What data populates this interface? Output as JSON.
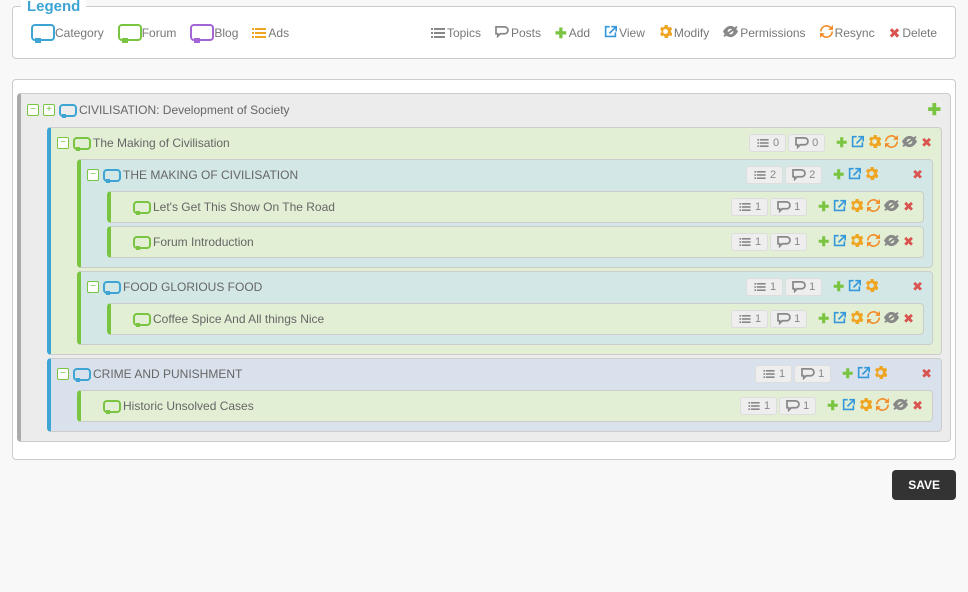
{
  "legend": {
    "title": "Legend",
    "types": [
      {
        "key": "category",
        "label": "Category",
        "icon": "cb-cat"
      },
      {
        "key": "forum",
        "label": "Forum",
        "icon": "cb-forum"
      },
      {
        "key": "blog",
        "label": "Blog",
        "icon": "cb-blog"
      },
      {
        "key": "ads",
        "label": "Ads",
        "icon": "list-lines"
      }
    ],
    "tools": [
      {
        "key": "topics",
        "label": "Topics",
        "icon": "list-gray"
      },
      {
        "key": "posts",
        "label": "Posts",
        "icon": "posts"
      },
      {
        "key": "add",
        "label": "Add",
        "icon": "plus"
      },
      {
        "key": "view",
        "label": "View",
        "icon": "view"
      },
      {
        "key": "modify",
        "label": "Modify",
        "icon": "gear"
      },
      {
        "key": "permissions",
        "label": "Permissions",
        "icon": "eye"
      },
      {
        "key": "resync",
        "label": "Resync",
        "icon": "resync"
      },
      {
        "key": "delete",
        "label": "Delete",
        "icon": "cross"
      }
    ]
  },
  "tree": [
    {
      "title": "CIVILISATION: Development of Society",
      "type": "category",
      "bg": "bg-gray",
      "bl": "bl-gray",
      "topics": null,
      "posts": null,
      "showAdd": true,
      "actions": [],
      "children": [
        {
          "title": "The Making of Civilisation",
          "type": "forum",
          "bg": "bg-green",
          "bl": "bl-blue",
          "topics": "0",
          "posts": "0",
          "actions": [
            "add",
            "view",
            "gear",
            "resync",
            "eye",
            "cross"
          ],
          "children": [
            {
              "title": "THE MAKING OF CIVILISATION",
              "type": "category",
              "bg": "bg-teal",
              "bl": "bl-green",
              "topics": "2",
              "posts": "2",
              "actions": [
                "add",
                "view",
                "gear",
                "",
                "",
                "cross"
              ],
              "children": [
                {
                  "title": "Let's Get This Show On The Road",
                  "type": "forum",
                  "bg": "bg-green",
                  "bl": "bl-green",
                  "topics": "1",
                  "posts": "1",
                  "actions": [
                    "add",
                    "view",
                    "gear",
                    "resync",
                    "eye",
                    "cross"
                  ],
                  "children": []
                },
                {
                  "title": "Forum Introduction",
                  "type": "forum",
                  "bg": "bg-green",
                  "bl": "bl-green",
                  "topics": "1",
                  "posts": "1",
                  "actions": [
                    "add",
                    "view",
                    "gear",
                    "resync",
                    "eye",
                    "cross"
                  ],
                  "children": []
                }
              ]
            },
            {
              "title": "FOOD GLORIOUS FOOD",
              "type": "category",
              "bg": "bg-teal",
              "bl": "bl-green",
              "topics": "1",
              "posts": "1",
              "actions": [
                "add",
                "view",
                "gear",
                "",
                "",
                "cross"
              ],
              "children": [
                {
                  "title": "Coffee Spice And All things Nice",
                  "type": "forum",
                  "bg": "bg-green",
                  "bl": "bl-green",
                  "topics": "1",
                  "posts": "1",
                  "actions": [
                    "add",
                    "view",
                    "gear",
                    "resync",
                    "eye",
                    "cross"
                  ],
                  "children": []
                }
              ]
            }
          ]
        },
        {
          "title": "CRIME AND PUNISHMENT",
          "type": "category",
          "bg": "bg-blue",
          "bl": "bl-blue",
          "topics": "1",
          "posts": "1",
          "actions": [
            "add",
            "view",
            "gear",
            "",
            "",
            "cross"
          ],
          "children": [
            {
              "title": "Historic Unsolved Cases",
              "type": "forum",
              "bg": "bg-green",
              "bl": "bl-green",
              "topics": "1",
              "posts": "1",
              "actions": [
                "add",
                "view",
                "gear",
                "resync",
                "eye",
                "cross"
              ],
              "children": []
            }
          ]
        }
      ]
    }
  ],
  "buttons": {
    "save": "SAVE"
  }
}
